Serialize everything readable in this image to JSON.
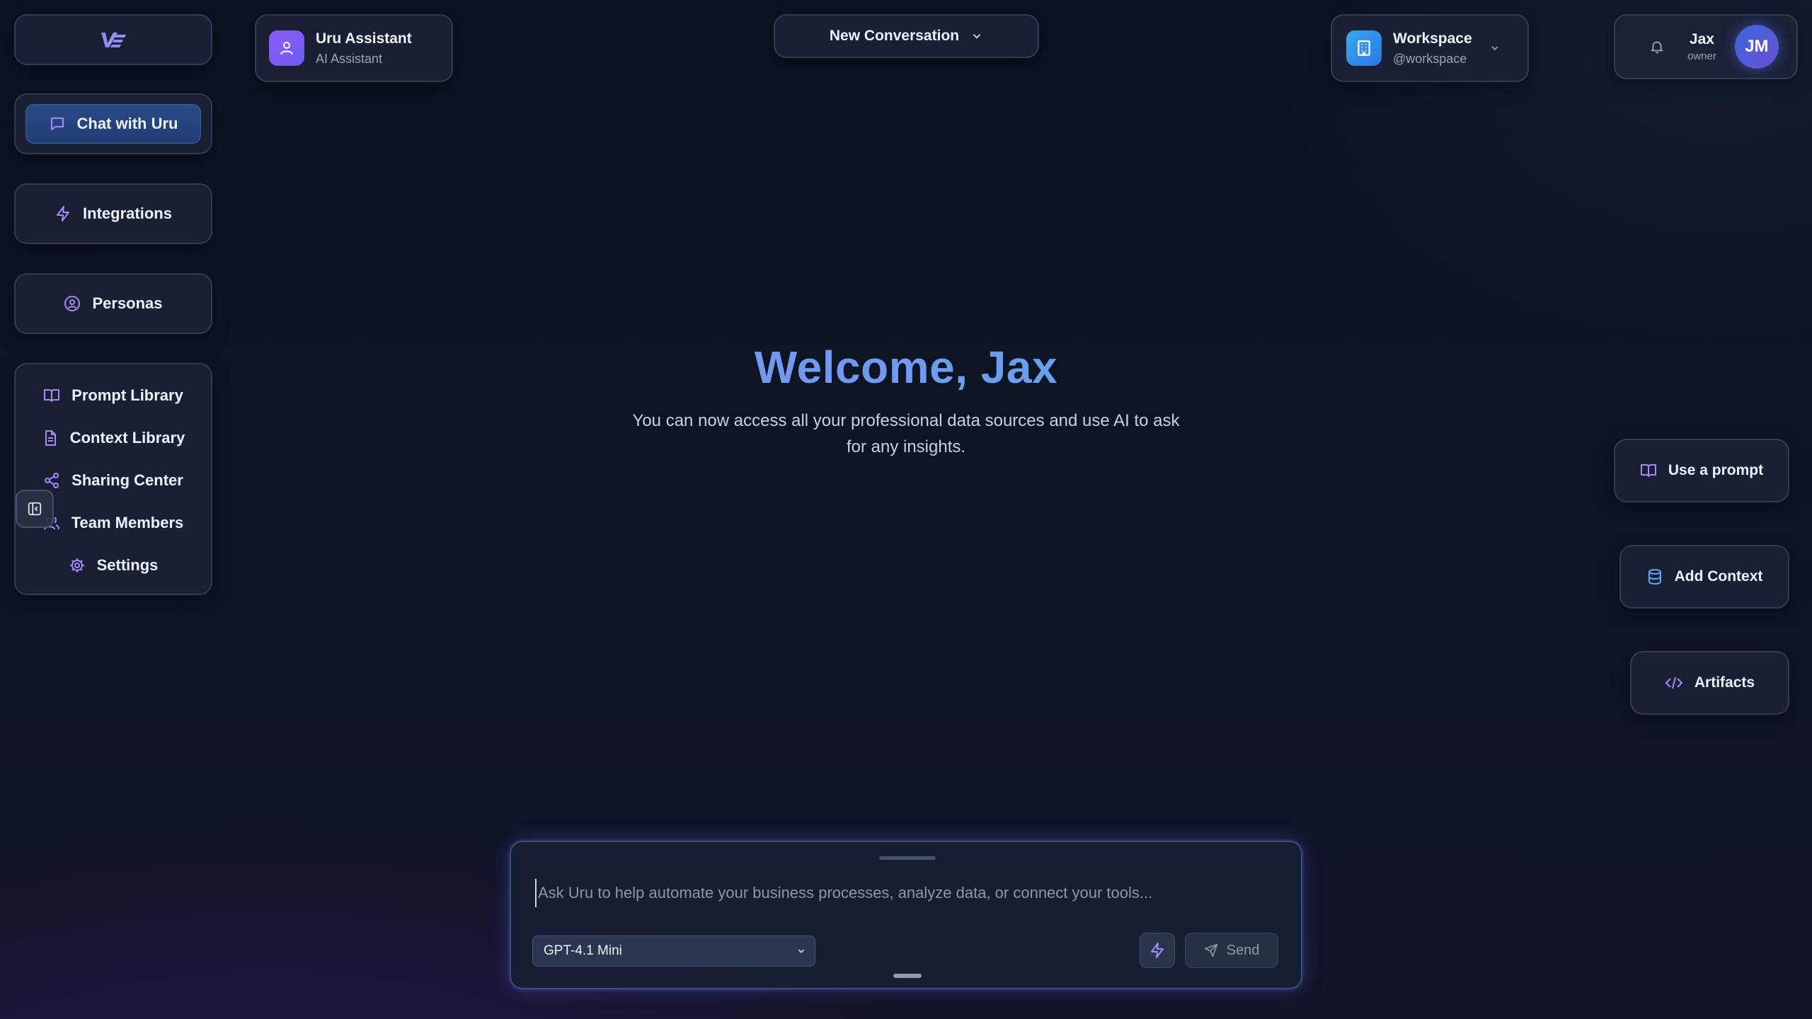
{
  "sidebar": {
    "logo_icon": "uru-logo-icon",
    "chat": {
      "label": "Chat with Uru",
      "icon": "chat-bubble-icon"
    },
    "integrations": {
      "label": "Integrations",
      "icon": "bolt-icon"
    },
    "personas": {
      "label": "Personas",
      "icon": "user-circle-icon"
    },
    "items": [
      {
        "label": "Prompt Library",
        "icon": "book-icon"
      },
      {
        "label": "Context Library",
        "icon": "document-icon"
      },
      {
        "label": "Sharing Center",
        "icon": "share-icon"
      },
      {
        "label": "Team Members",
        "icon": "users-icon"
      },
      {
        "label": "Settings",
        "icon": "gear-icon"
      }
    ]
  },
  "header": {
    "assistant": {
      "name": "Uru Assistant",
      "subtitle": "AI Assistant",
      "icon": "user-icon"
    },
    "conversation": {
      "label": "New Conversation",
      "icon": "chevron-down-icon"
    },
    "workspace": {
      "name": "Workspace",
      "handle": "@workspace",
      "icon": "building-icon"
    },
    "user": {
      "name": "Jax",
      "role": "owner",
      "initials": "JM",
      "bell_icon": "bell-icon"
    }
  },
  "welcome": {
    "title": "Welcome, Jax",
    "subtitle": "You can now access all your professional data sources and use AI to ask for any insights."
  },
  "actions": [
    {
      "label": "Use a prompt",
      "icon": "book-icon"
    },
    {
      "label": "Add Context",
      "icon": "database-icon"
    },
    {
      "label": "Artifacts",
      "icon": "code-icon"
    }
  ],
  "composer": {
    "placeholder": "Ask Uru to help automate your business processes, analyze data, or connect your tools...",
    "value": "",
    "model": "GPT-4.1 Mini",
    "send_label": "Send"
  },
  "colors": {
    "accent_purple": "#a78bfa",
    "accent_blue": "#3b82f6",
    "background": "#0d1425"
  }
}
